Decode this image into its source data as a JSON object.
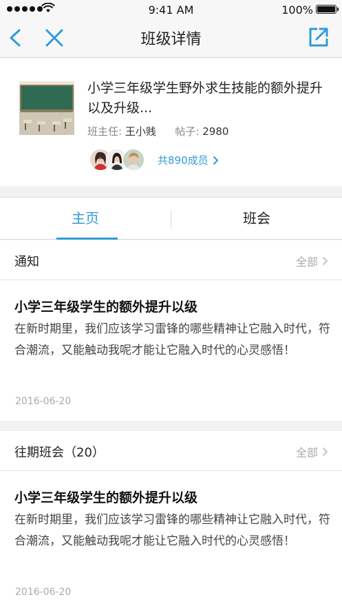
{
  "status_bar": {
    "time": "9:41 AM",
    "battery_text": "100%"
  },
  "nav": {
    "title": "班级详情",
    "back_icon": "chevron-left-icon",
    "close_icon": "close-icon",
    "share_icon": "share-icon"
  },
  "class_info": {
    "title": "小学三年级学生野外求生技能的额外提升以及升级...",
    "teacher_label": "班主任:",
    "teacher_name": "王小贱",
    "posts_label": "帖子:",
    "posts_count": "2980",
    "members_link": "共890成员"
  },
  "tabs": [
    {
      "label": "主页",
      "active": true
    },
    {
      "label": "班会",
      "active": false
    }
  ],
  "notice_section": {
    "label": "通知",
    "more": "全部",
    "post": {
      "title": "小学三年级学生的额外提升以级",
      "body": "在新时期里，我们应该学习雷锋的哪些精神让它融入时代，符合潮流，又能触动我呢才能让它融入时代的心灵感悟！",
      "date": "2016-06-20"
    }
  },
  "meetings_section": {
    "label": "往期班会（20）",
    "more": "全部",
    "post": {
      "title": "小学三年级学生的额外提升以级",
      "body": "在新时期里，我们应该学习雷锋的哪些精神让它融入时代，符合潮流，又能触动我呢才能让它融入时代的心灵感悟！",
      "date": "2016-06-20"
    }
  },
  "colors": {
    "accent": "#2f9bd8",
    "background": "#f2f2f4",
    "muted_text": "#aaaaaa"
  }
}
